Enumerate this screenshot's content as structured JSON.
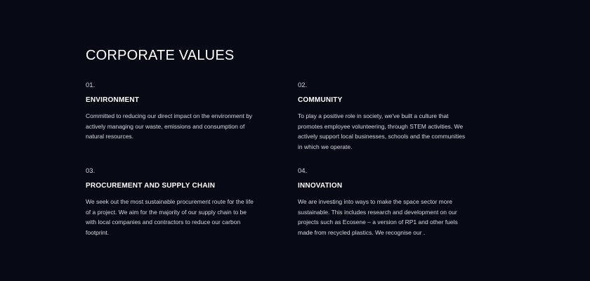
{
  "section": {
    "title": "CORPORATE VALUES",
    "values": [
      {
        "number": "01.",
        "heading": "ENVIRONMENT",
        "description": "Committed to reducing our direct impact on the environment by actively managing our waste, emissions and consumption of natural resources."
      },
      {
        "number": "02.",
        "heading": "COMMUNITY",
        "description": "To play a positive role in society, we've built a culture that promotes employee volunteering, through STEM activities. We actively support local businesses, schools and the communities in which we operate."
      },
      {
        "number": "03.",
        "heading": "PROCUREMENT AND SUPPLY CHAIN",
        "description": "We seek out the most sustainable procurement route for the life of a project. We aim for the majority of our supply chain to be with local companies and contractors to reduce our carbon footprint."
      },
      {
        "number": "04.",
        "heading": "INNOVATION",
        "description": "We are investing into ways to make the space sector more sustainable. This includes research and development on our projects such as Ecosene – a version of RP1 and other fuels made from recycled plastics. We recognise our ."
      }
    ]
  },
  "colors": {
    "background": "#070914",
    "text_primary": "#ffffff",
    "text_secondary": "#d7d9e0"
  }
}
